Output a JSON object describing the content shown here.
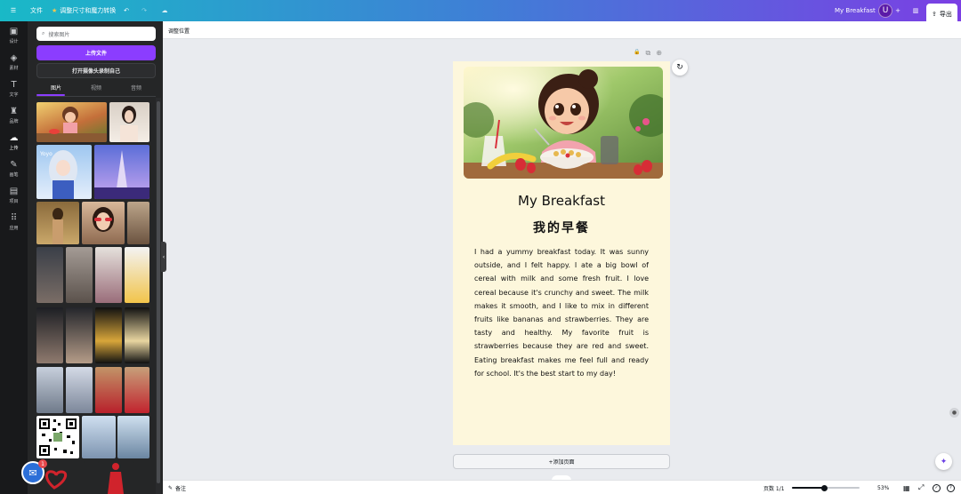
{
  "topbar": {
    "menu_icon": "☰",
    "file_label": "文件",
    "resize_label": "调整尺寸和魔力转换",
    "resize_icon": "★",
    "undo_icon": "↶",
    "redo_icon": "↷",
    "cloud_icon": "☁",
    "doc_title": "My Breakfast",
    "avatar_initial": "U",
    "add_icon": "+",
    "analytics_icon": "▥",
    "export_icon": "⇪",
    "export_label": "导出"
  },
  "rail": {
    "items": [
      {
        "label": "设计",
        "icon": "▣"
      },
      {
        "label": "素材",
        "icon": "◈"
      },
      {
        "label": "文字",
        "icon": "T"
      },
      {
        "label": "品牌",
        "icon": "♜"
      },
      {
        "label": "上传",
        "icon": "☁"
      },
      {
        "label": "画笔",
        "icon": "✎"
      },
      {
        "label": "项目",
        "icon": "▤"
      },
      {
        "label": "应用",
        "icon": "⠿"
      }
    ],
    "active_index": 4
  },
  "panel": {
    "search_placeholder": "搜索图片",
    "search_icon": "⌕",
    "upload_label": "上传文件",
    "camera_label": "打开摄像头录制自己",
    "tabs": [
      "图片",
      "视频",
      "音频"
    ],
    "active_tab": 0
  },
  "canvas": {
    "context_label": "调整位置",
    "lock_icon": "🔒",
    "duplicate_icon": "⧉",
    "add_page_icon": "⊕",
    "refresh_icon": "↻",
    "title": "My Breakfast",
    "subtitle": "我的早餐",
    "body": "I had a yummy breakfast today. It was sunny outside, and I felt happy. I ate a big bowl of cereal with milk and some fresh fruit. I love cereal because it's crunchy and sweet. The milk makes it smooth, and I like to mix in different fruits like bananas and strawberries. They are tasty and healthy. My favorite fruit is strawberries because they are red and sweet. Eating breakfast makes me feel full and ready for school. It's the best start to my day!",
    "add_page_label": "+添加页面"
  },
  "help_badge": "1",
  "bottombar": {
    "notes_icon": "✎",
    "notes_label": "备注",
    "pages_label": "页数 1/1",
    "zoom_value": 53,
    "zoom_label": "53%",
    "grid_icon": "▦",
    "fullscreen_icon": "⤢",
    "check_icon": "✓",
    "help_icon": "?"
  }
}
